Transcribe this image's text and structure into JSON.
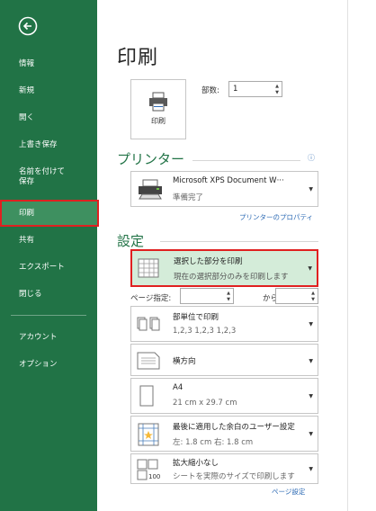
{
  "nav": {
    "items": [
      "情報",
      "新規",
      "開く",
      "上書き保存",
      "名前を付けて保存",
      "印刷",
      "共有",
      "エクスポート",
      "閉じる",
      "アカウント",
      "オプション"
    ],
    "saveas_line1": "名前を付けて",
    "saveas_line2": "保存"
  },
  "page_title": "印刷",
  "print_button": {
    "label": "印刷"
  },
  "copies": {
    "label": "部数:",
    "value": "1"
  },
  "printer": {
    "section_title": "プリンター",
    "name": "Microsoft XPS Document W···",
    "status": "準備完了",
    "properties_link": "プリンターのプロパティ"
  },
  "settings": {
    "section_title": "設定",
    "what": {
      "line1": "選択した部分を印刷",
      "line2": "現在の選択部分のみを印刷します"
    },
    "pages": {
      "label": "ページ指定:",
      "to_label": "から"
    },
    "collate": {
      "line1": "部単位で印刷",
      "line2": "1,2,3   1,2,3   1,2,3"
    },
    "orientation": {
      "line1": "横方向"
    },
    "paper": {
      "line1": "A4",
      "line2": "21 cm x 29.7 cm"
    },
    "margins": {
      "line1": "最後に適用した余白のユーザー設定",
      "line2": "左:  1.8 cm    右:  1.8 cm"
    },
    "scaling": {
      "line1": "拡大縮小なし",
      "line2": "シートを実際のサイズで印刷します"
    },
    "page_setup_link": "ページ設定"
  },
  "colors": {
    "sidebar": "#217346",
    "sidebar_selected": "#3e9060",
    "highlight_border": "#e02020",
    "selected_dd_bg": "#d4ecd9"
  }
}
